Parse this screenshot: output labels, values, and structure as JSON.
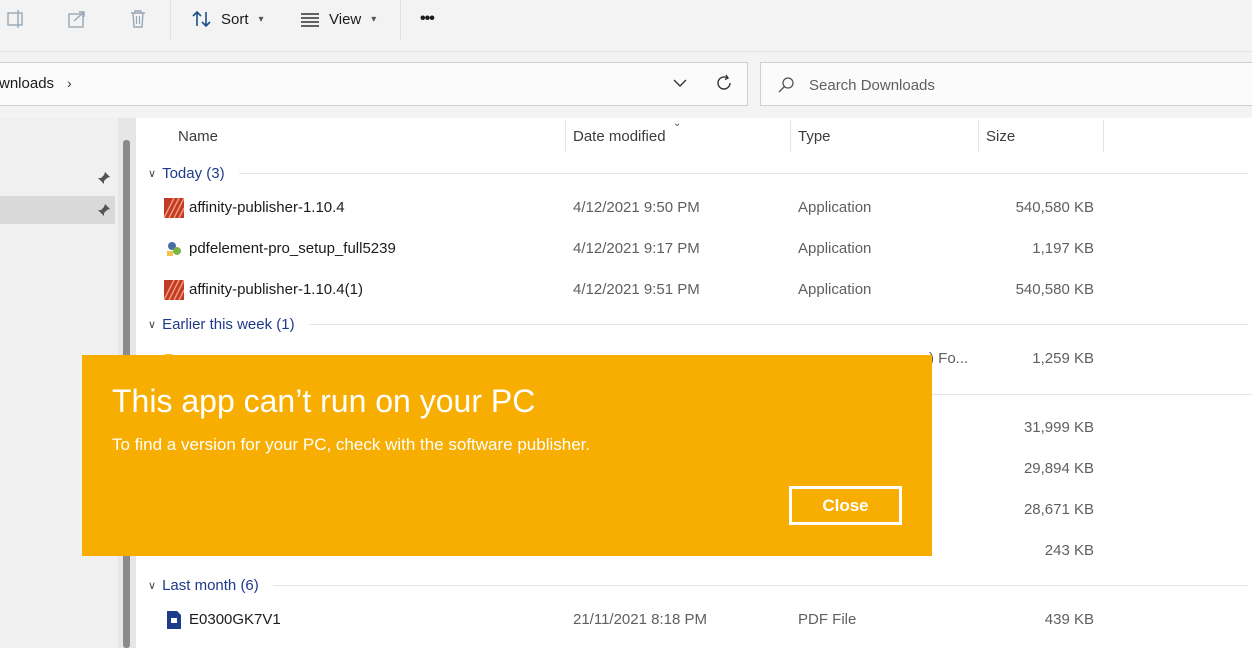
{
  "toolbar": {
    "sort_label": "Sort",
    "view_label": "View",
    "more_label": "•••"
  },
  "address": {
    "path_text": "wnloads",
    "separator": "›"
  },
  "search": {
    "placeholder": "Search Downloads"
  },
  "columns": {
    "name": "Name",
    "date": "Date modified",
    "type": "Type",
    "size": "Size"
  },
  "groups": {
    "today": "Today (3)",
    "earlier_week": "Earlier this week (1)",
    "last_month": "Last month (6)"
  },
  "files": [
    {
      "name": "affinity-publisher-1.10.4",
      "date": "4/12/2021 9:50 PM",
      "type": "Application",
      "size": "540,580 KB",
      "icon": "affinity-app-icon"
    },
    {
      "name": "pdfelement-pro_setup_full5239",
      "date": "4/12/2021 9:17 PM",
      "type": "Application",
      "size": "1,197 KB",
      "icon": "installer-app-icon"
    },
    {
      "name": "affinity-publisher-1.10.4(1)",
      "date": "4/12/2021 9:51 PM",
      "type": "Application",
      "size": "540,580 KB",
      "icon": "affinity-app-icon"
    }
  ],
  "partial_rows": {
    "type_fragment": ") Fo...",
    "sizes": [
      "1,259 KB",
      "31,999 KB",
      "29,894 KB",
      "28,671 KB",
      "243 KB"
    ]
  },
  "last_file": {
    "name": "E0300GK7V1",
    "date": "21/11/2021 8:18 PM",
    "type": "PDF File",
    "size": "439 KB",
    "icon": "pdf-file-icon"
  },
  "dialog": {
    "title": "This app can’t run on your PC",
    "message": "To find a version for your PC, check with the software publisher.",
    "close_label": "Close"
  },
  "colors": {
    "dialog_bg": "#f7ae00",
    "group_text": "#1e3a8a",
    "selection": "#d9d9d9"
  }
}
